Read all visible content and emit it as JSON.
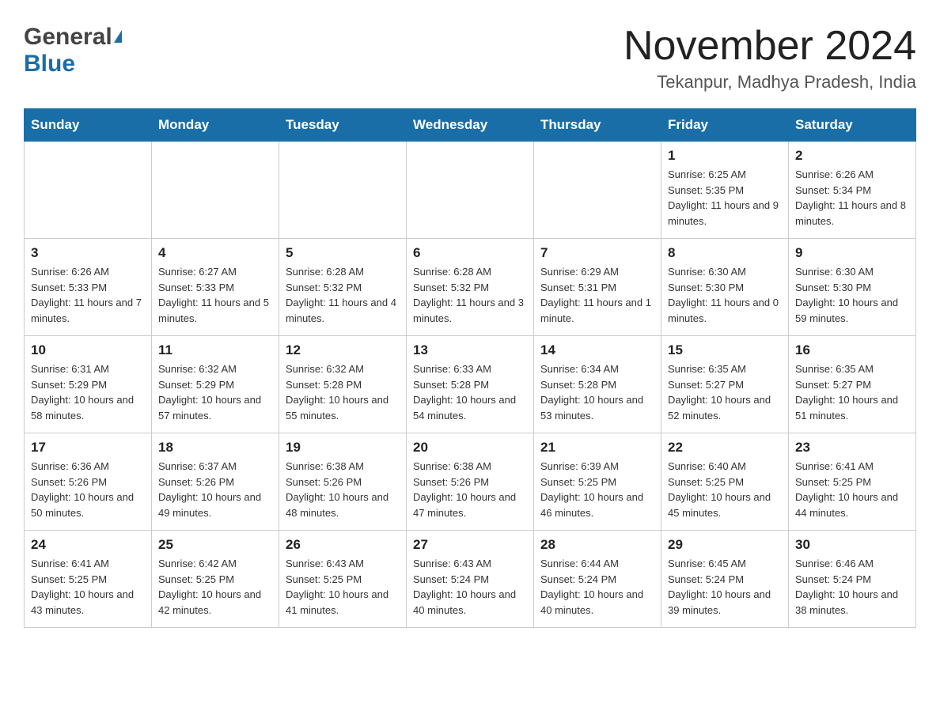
{
  "header": {
    "logo_general": "General",
    "logo_blue": "Blue",
    "month_title": "November 2024",
    "location": "Tekanpur, Madhya Pradesh, India"
  },
  "days_of_week": [
    "Sunday",
    "Monday",
    "Tuesday",
    "Wednesday",
    "Thursday",
    "Friday",
    "Saturday"
  ],
  "weeks": [
    [
      {
        "day": "",
        "info": ""
      },
      {
        "day": "",
        "info": ""
      },
      {
        "day": "",
        "info": ""
      },
      {
        "day": "",
        "info": ""
      },
      {
        "day": "",
        "info": ""
      },
      {
        "day": "1",
        "info": "Sunrise: 6:25 AM\nSunset: 5:35 PM\nDaylight: 11 hours and 9 minutes."
      },
      {
        "day": "2",
        "info": "Sunrise: 6:26 AM\nSunset: 5:34 PM\nDaylight: 11 hours and 8 minutes."
      }
    ],
    [
      {
        "day": "3",
        "info": "Sunrise: 6:26 AM\nSunset: 5:33 PM\nDaylight: 11 hours and 7 minutes."
      },
      {
        "day": "4",
        "info": "Sunrise: 6:27 AM\nSunset: 5:33 PM\nDaylight: 11 hours and 5 minutes."
      },
      {
        "day": "5",
        "info": "Sunrise: 6:28 AM\nSunset: 5:32 PM\nDaylight: 11 hours and 4 minutes."
      },
      {
        "day": "6",
        "info": "Sunrise: 6:28 AM\nSunset: 5:32 PM\nDaylight: 11 hours and 3 minutes."
      },
      {
        "day": "7",
        "info": "Sunrise: 6:29 AM\nSunset: 5:31 PM\nDaylight: 11 hours and 1 minute."
      },
      {
        "day": "8",
        "info": "Sunrise: 6:30 AM\nSunset: 5:30 PM\nDaylight: 11 hours and 0 minutes."
      },
      {
        "day": "9",
        "info": "Sunrise: 6:30 AM\nSunset: 5:30 PM\nDaylight: 10 hours and 59 minutes."
      }
    ],
    [
      {
        "day": "10",
        "info": "Sunrise: 6:31 AM\nSunset: 5:29 PM\nDaylight: 10 hours and 58 minutes."
      },
      {
        "day": "11",
        "info": "Sunrise: 6:32 AM\nSunset: 5:29 PM\nDaylight: 10 hours and 57 minutes."
      },
      {
        "day": "12",
        "info": "Sunrise: 6:32 AM\nSunset: 5:28 PM\nDaylight: 10 hours and 55 minutes."
      },
      {
        "day": "13",
        "info": "Sunrise: 6:33 AM\nSunset: 5:28 PM\nDaylight: 10 hours and 54 minutes."
      },
      {
        "day": "14",
        "info": "Sunrise: 6:34 AM\nSunset: 5:28 PM\nDaylight: 10 hours and 53 minutes."
      },
      {
        "day": "15",
        "info": "Sunrise: 6:35 AM\nSunset: 5:27 PM\nDaylight: 10 hours and 52 minutes."
      },
      {
        "day": "16",
        "info": "Sunrise: 6:35 AM\nSunset: 5:27 PM\nDaylight: 10 hours and 51 minutes."
      }
    ],
    [
      {
        "day": "17",
        "info": "Sunrise: 6:36 AM\nSunset: 5:26 PM\nDaylight: 10 hours and 50 minutes."
      },
      {
        "day": "18",
        "info": "Sunrise: 6:37 AM\nSunset: 5:26 PM\nDaylight: 10 hours and 49 minutes."
      },
      {
        "day": "19",
        "info": "Sunrise: 6:38 AM\nSunset: 5:26 PM\nDaylight: 10 hours and 48 minutes."
      },
      {
        "day": "20",
        "info": "Sunrise: 6:38 AM\nSunset: 5:26 PM\nDaylight: 10 hours and 47 minutes."
      },
      {
        "day": "21",
        "info": "Sunrise: 6:39 AM\nSunset: 5:25 PM\nDaylight: 10 hours and 46 minutes."
      },
      {
        "day": "22",
        "info": "Sunrise: 6:40 AM\nSunset: 5:25 PM\nDaylight: 10 hours and 45 minutes."
      },
      {
        "day": "23",
        "info": "Sunrise: 6:41 AM\nSunset: 5:25 PM\nDaylight: 10 hours and 44 minutes."
      }
    ],
    [
      {
        "day": "24",
        "info": "Sunrise: 6:41 AM\nSunset: 5:25 PM\nDaylight: 10 hours and 43 minutes."
      },
      {
        "day": "25",
        "info": "Sunrise: 6:42 AM\nSunset: 5:25 PM\nDaylight: 10 hours and 42 minutes."
      },
      {
        "day": "26",
        "info": "Sunrise: 6:43 AM\nSunset: 5:25 PM\nDaylight: 10 hours and 41 minutes."
      },
      {
        "day": "27",
        "info": "Sunrise: 6:43 AM\nSunset: 5:24 PM\nDaylight: 10 hours and 40 minutes."
      },
      {
        "day": "28",
        "info": "Sunrise: 6:44 AM\nSunset: 5:24 PM\nDaylight: 10 hours and 40 minutes."
      },
      {
        "day": "29",
        "info": "Sunrise: 6:45 AM\nSunset: 5:24 PM\nDaylight: 10 hours and 39 minutes."
      },
      {
        "day": "30",
        "info": "Sunrise: 6:46 AM\nSunset: 5:24 PM\nDaylight: 10 hours and 38 minutes."
      }
    ]
  ]
}
